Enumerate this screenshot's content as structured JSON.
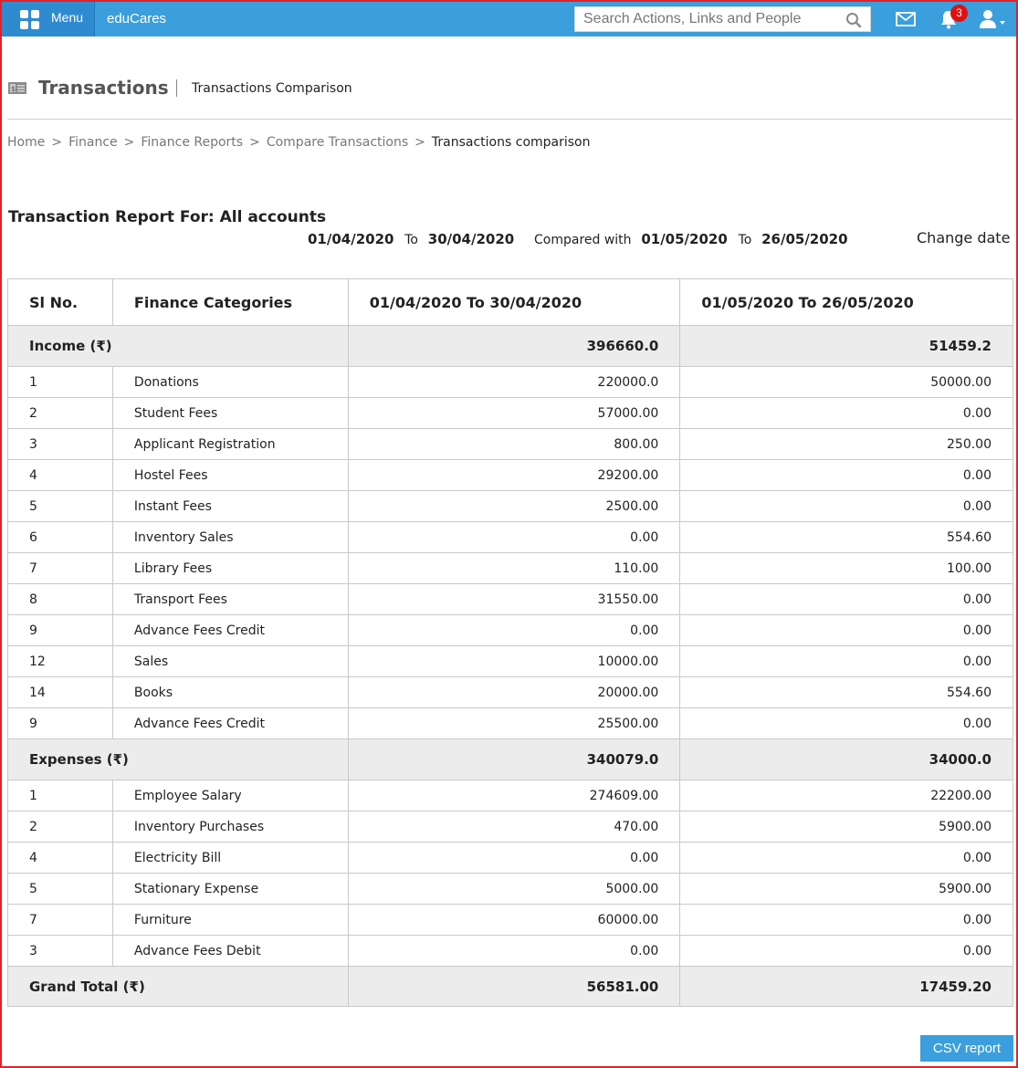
{
  "topbar": {
    "menu_label": "Menu",
    "brand": "eduCares",
    "search_placeholder": "Search Actions, Links and People",
    "notification_count": "3",
    "accent_color": "#3a9fdc"
  },
  "header": {
    "title": "Transactions",
    "subtitle": "Transactions Comparison"
  },
  "breadcrumb": [
    "Home",
    "Finance",
    "Finance Reports",
    "Compare Transactions",
    "Transactions comparison"
  ],
  "report": {
    "heading": "Transaction Report For: All accounts",
    "start_date_1": "01/04/2020",
    "to_1": "To",
    "end_date_1": "30/04/2020",
    "compared_with": "Compared with",
    "start_date_2": "01/05/2020",
    "to_2": "To",
    "end_date_2": "26/05/2020",
    "change_date": "Change date"
  },
  "table": {
    "headers": [
      "Sl No.",
      "Finance Categories",
      "01/04/2020 To 30/04/2020",
      "01/05/2020 To 26/05/2020"
    ],
    "income": {
      "label": "Income (₹)",
      "total_1": "396660.0",
      "total_2": "51459.2",
      "rows": [
        [
          "1",
          "Donations",
          "220000.0",
          "50000.00"
        ],
        [
          "2",
          "Student Fees",
          "57000.00",
          "0.00"
        ],
        [
          "3",
          "Applicant Registration",
          "800.00",
          "250.00"
        ],
        [
          "4",
          "Hostel Fees",
          "29200.00",
          "0.00"
        ],
        [
          "5",
          "Instant Fees",
          "2500.00",
          "0.00"
        ],
        [
          "6",
          "Inventory Sales",
          "0.00",
          "554.60"
        ],
        [
          "7",
          "Library Fees",
          "110.00",
          "100.00"
        ],
        [
          "8",
          "Transport Fees",
          "31550.00",
          "0.00"
        ],
        [
          "9",
          "Advance Fees Credit",
          "0.00",
          "0.00"
        ],
        [
          "12",
          "Sales",
          "10000.00",
          "0.00"
        ],
        [
          "14",
          "Books",
          "20000.00",
          "554.60"
        ],
        [
          "9",
          "Advance Fees Credit",
          "25500.00",
          "0.00"
        ]
      ]
    },
    "expenses": {
      "label": "Expenses (₹)",
      "total_1": "340079.0",
      "total_2": "34000.0",
      "rows": [
        [
          "1",
          "Employee Salary",
          "274609.00",
          "22200.00"
        ],
        [
          "2",
          "Inventory Purchases",
          "470.00",
          "5900.00"
        ],
        [
          "4",
          "Electricity Bill",
          "0.00",
          "0.00"
        ],
        [
          "5",
          "Stationary Expense",
          "5000.00",
          "5900.00"
        ],
        [
          "7",
          "Furniture",
          "60000.00",
          "0.00"
        ],
        [
          "3",
          "Advance Fees Debit",
          "0.00",
          "0.00"
        ]
      ]
    },
    "grand_total": {
      "label": "Grand Total (₹)",
      "total_1": "56581.00",
      "total_2": "17459.20"
    }
  },
  "csv_button": "CSV report"
}
